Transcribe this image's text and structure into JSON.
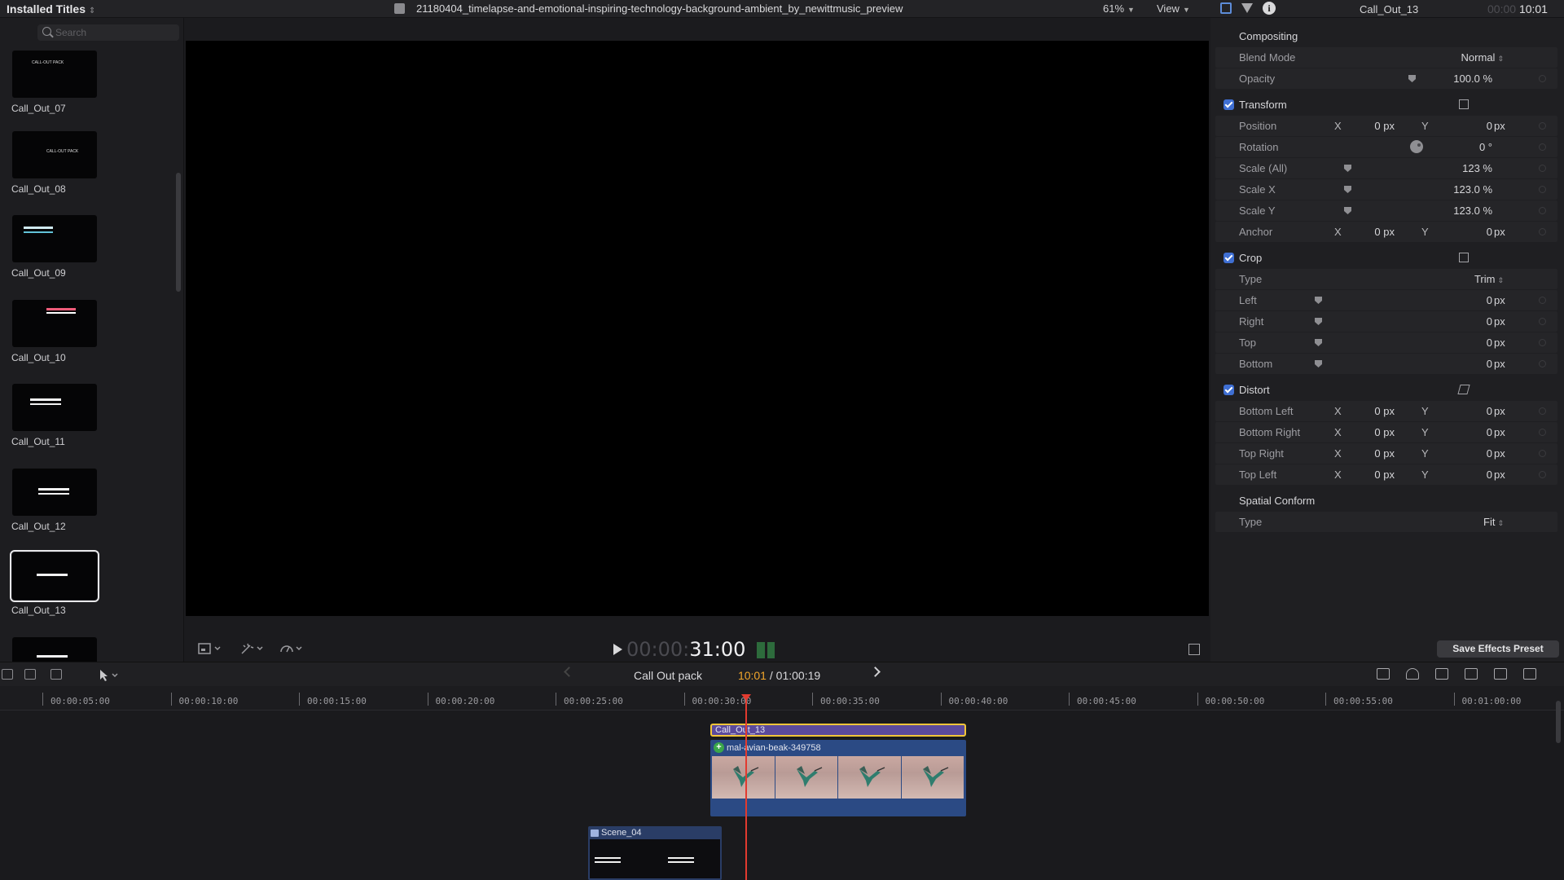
{
  "topbar": {
    "library_title": "Installed Titles",
    "viewer_title": "21180404_timelapse-and-emotional-inspiring-technology-background-ambient_by_newittmusic_preview",
    "zoom": "61%",
    "view_menu": "View",
    "inspector_clip_name": "Call_Out_13",
    "inspector_tc_dim": "00:00",
    "inspector_tc": "10:01"
  },
  "browser": {
    "search_placeholder": "Search",
    "items": [
      {
        "label": "Call_Out_07"
      },
      {
        "label": "Call_Out_08"
      },
      {
        "label": "Call_Out_09"
      },
      {
        "label": "Call_Out_10"
      },
      {
        "label": "Call_Out_11"
      },
      {
        "label": "Call_Out_12"
      },
      {
        "label": "Call_Out_13"
      }
    ],
    "thumb_text_07": "CALL-OUT PACK",
    "thumb_text_08": "CALL-OUT PACK"
  },
  "viewer": {
    "timecode_dim": "00:00:",
    "timecode": "31:00"
  },
  "inspector": {
    "compositing": "Compositing",
    "blend_mode_label": "Blend Mode",
    "blend_mode_value": "Normal",
    "opacity_label": "Opacity",
    "opacity_value": "100.0 %",
    "transform": "Transform",
    "position_label": "Position",
    "rotation_label": "Rotation",
    "rotation_value": "0 °",
    "scale_all_label": "Scale (All)",
    "scale_all_value": "123 %",
    "scale_x_label": "Scale X",
    "scale_x_value": "123.0 %",
    "scale_y_label": "Scale Y",
    "scale_y_value": "123.0 %",
    "anchor_label": "Anchor",
    "crop": "Crop",
    "crop_type_label": "Type",
    "crop_type_value": "Trim",
    "left_label": "Left",
    "right_label": "Right",
    "top_label": "Top",
    "bottom_label": "Bottom",
    "distort": "Distort",
    "bottom_left_label": "Bottom Left",
    "bottom_right_label": "Bottom Right",
    "top_right_label": "Top Right",
    "top_left_label": "Top Left",
    "spatial_conform": "Spatial Conform",
    "conform_type_label": "Type",
    "conform_type_value": "Fit",
    "x": "X",
    "y": "Y",
    "zero": "0",
    "px": "px",
    "zero_px": "0 px",
    "save_effects_preset": "Save Effects Preset"
  },
  "timeline": {
    "project_name": "Call Out pack",
    "position_tc": "10:01",
    "duration_tc": " / 01:00:19",
    "ruler": [
      "00:00:05:00",
      "00:00:10:00",
      "00:00:15:00",
      "00:00:20:00",
      "00:00:25:00",
      "00:00:30:00",
      "00:00:35:00",
      "00:00:40:00",
      "00:00:45:00",
      "00:00:50:00",
      "00:00:55:00",
      "00:01:00:00"
    ],
    "title_clip": "Call_Out_13",
    "video_clip": "mal-avian-beak-349758",
    "scene_clip": "Scene_04"
  },
  "colors": {
    "accent_blue": "#3f6fd3",
    "title_clip": "#5b4a9c",
    "selection_yellow": "#f2c53a",
    "playhead": "#e23a2f",
    "timecode_orange": "#f2a62b"
  }
}
